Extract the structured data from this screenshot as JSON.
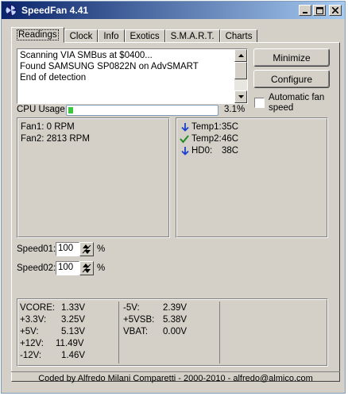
{
  "window": {
    "title": "SpeedFan 4.41"
  },
  "tabs": [
    "Readings",
    "Clock",
    "Info",
    "Exotics",
    "S.M.A.R.T.",
    "Charts"
  ],
  "log": {
    "lines": [
      "Scanning VIA SMBus at $0400...",
      "Found SAMSUNG SP0822N on AdvSMART",
      "End of detection"
    ]
  },
  "buttons": {
    "minimize": "Minimize",
    "configure": "Configure"
  },
  "auto_fan": {
    "label_line1": "Automatic fan",
    "label_line2": "speed",
    "checked": false
  },
  "cpu": {
    "label": "CPU Usage",
    "percent_text": "3.1%",
    "percent": 3.1
  },
  "fans": [
    "Fan1: 0 RPM",
    "Fan2: 2813 RPM"
  ],
  "temps": [
    {
      "label": "Temp1:",
      "value": "35C",
      "icon": "arrow-down-icon"
    },
    {
      "label": "Temp2:",
      "value": "46C",
      "icon": "check-icon"
    },
    {
      "label": "HD0:",
      "value": "38C",
      "icon": "arrow-down-icon"
    }
  ],
  "speeds": [
    {
      "label": "Speed01:",
      "value": "100",
      "unit": "%"
    },
    {
      "label": "Speed02:",
      "value": "100",
      "unit": "%"
    }
  ],
  "voltages_left": [
    {
      "label": "VCORE:",
      "value": "1.33V"
    },
    {
      "label": "+3.3V:",
      "value": "3.25V"
    },
    {
      "label": "+5V:",
      "value": "5.13V"
    },
    {
      "label": "+12V:",
      "value": "11.49V"
    },
    {
      "label": "-12V:",
      "value": "1.46V"
    }
  ],
  "voltages_right": [
    {
      "label": "-5V:",
      "value": "2.39V"
    },
    {
      "label": "+5VSB:",
      "value": "5.38V"
    },
    {
      "label": "VBAT:",
      "value": "0.00V"
    }
  ],
  "status": "Coded by Alfredo Milani Comparetti - 2000-2010 - alfredo@almico.com",
  "colors": {
    "title_start": "#0a246a",
    "title_end": "#a6caf0",
    "progress": "#3cc83c",
    "arrow_blue": "#1a3fd0",
    "check_green": "#208a20"
  }
}
